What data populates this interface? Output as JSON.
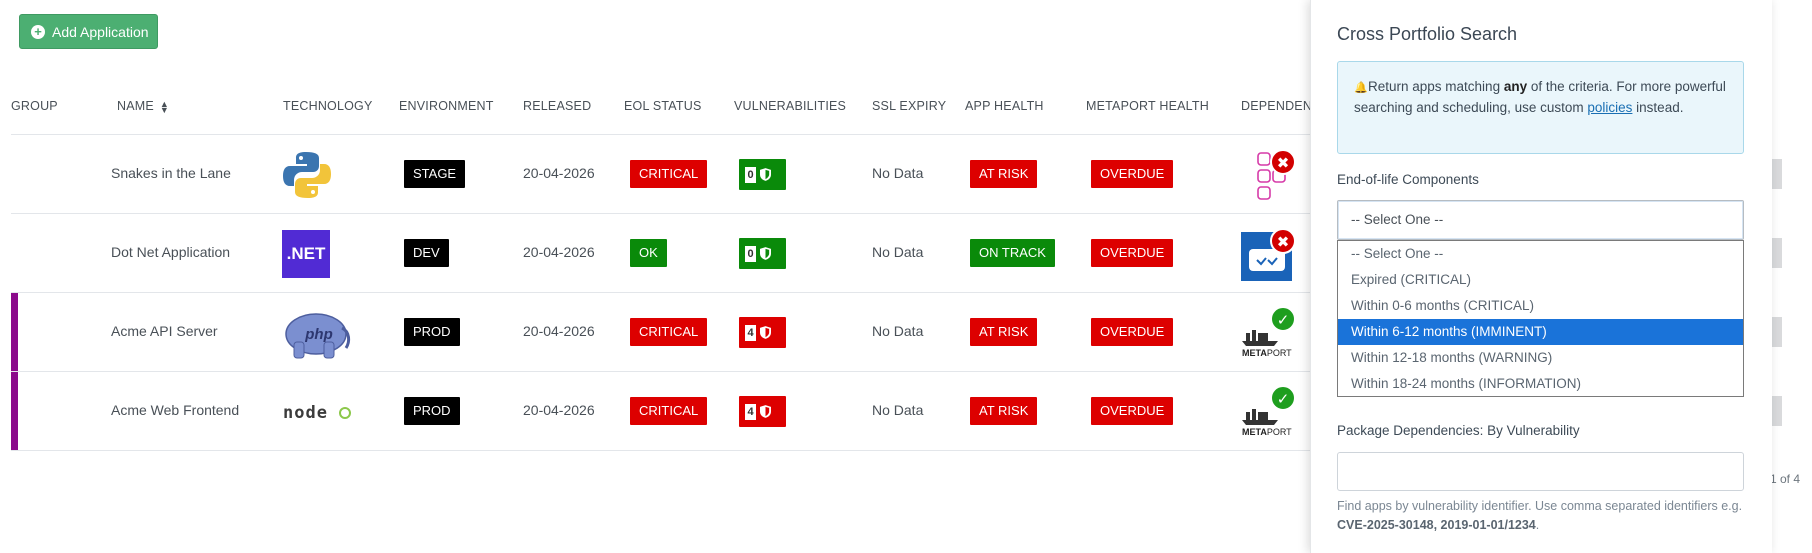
{
  "toolbar": {
    "add_label": "Add Application"
  },
  "table": {
    "headers": {
      "group": "GROUP",
      "name": "NAME",
      "technology": "TECHNOLOGY",
      "environment": "ENVIRONMENT",
      "released": "RELEASED",
      "eol": "EOL STATUS",
      "vulns": "VULNERABILITIES",
      "ssl": "SSL EXPIRY",
      "health": "APP HEALTH",
      "metaport": "METAPORT HEALTH",
      "deps": "DEPENDENC"
    },
    "rows": [
      {
        "name": "Snakes in the Lane",
        "tech": "python-logo",
        "env": "STAGE",
        "released": "20-04-2026",
        "eol": "CRITICAL",
        "vuln": "0",
        "ssl": "No Data",
        "health": "AT RISK",
        "metaport": "OVERDUE",
        "group": false
      },
      {
        "name": "Dot Net Application",
        "tech": ".NET",
        "env": "DEV",
        "released": "20-04-2026",
        "eol": "OK",
        "vuln": "0",
        "ssl": "No Data",
        "health": "ON TRACK",
        "metaport": "OVERDUE",
        "group": false
      },
      {
        "name": "Acme API Server",
        "tech": "php",
        "env": "PROD",
        "released": "20-04-2026",
        "eol": "CRITICAL",
        "vuln": "4",
        "ssl": "No Data",
        "health": "AT RISK",
        "metaport": "OVERDUE",
        "group": true
      },
      {
        "name": "Acme Web Frontend",
        "tech": "node",
        "env": "PROD",
        "released": "20-04-2026",
        "eol": "CRITICAL",
        "vuln": "4",
        "ssl": "No Data",
        "health": "AT RISK",
        "metaport": "OVERDUE",
        "group": true
      }
    ],
    "metaport_logo": "META",
    "metaport_logo2": "PORT",
    "pagination_text": "1 of 4",
    "status_glyphs": {
      "fail": "✖",
      "pass": "✓"
    }
  },
  "panel": {
    "title": "Cross Portfolio Search",
    "info": {
      "pre": "Return apps matching ",
      "bold": "any",
      "post": " of the criteria. For more powerful searching and scheduling, use custom ",
      "link": "policies",
      "end": " instead."
    },
    "eol_label": "End-of-life Components",
    "select_value": "-- Select One --",
    "options": [
      "-- Select One --",
      "Expired (CRITICAL)",
      "Within 0-6 months (CRITICAL)",
      "Within 6-12 months (IMMINENT)",
      "Within 12-18 months (WARNING)",
      "Within 18-24 months (INFORMATION)"
    ],
    "selected_option_index": 3,
    "pkg_label": "Package Dependencies: By Vulnerability",
    "pkg_value": "",
    "help_pre": "Find apps by vulnerability identifier. Use comma separated identifiers e.g. ",
    "help_bold": "CVE-2025-30148, 2019-01-01/1234",
    "help_end": "."
  },
  "colors": {
    "critical": "#dd0000",
    "ok": "#0a8a0a",
    "group": "#8b0a8b",
    "accent": "#4caf72",
    "selected": "#1a73d9"
  }
}
